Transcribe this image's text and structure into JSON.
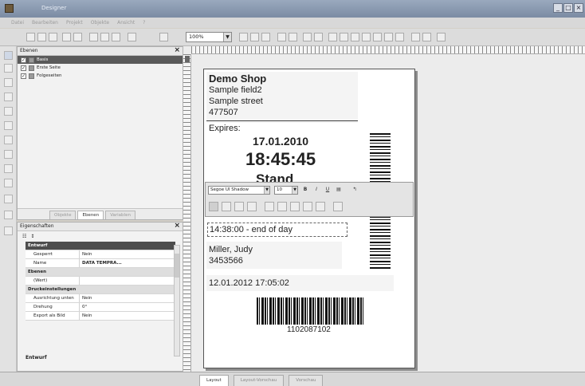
{
  "window": {
    "title": "Designer",
    "controls": [
      "_",
      "□",
      "×"
    ]
  },
  "menu": [
    "Datei",
    "Bearbeiten",
    "Projekt",
    "Objekte",
    "Ansicht",
    "?"
  ],
  "toolbar": {
    "zoom": "100%"
  },
  "layers_panel": {
    "title": "Ebenen",
    "items": [
      {
        "label": "Basis",
        "checked": true,
        "selected": true
      },
      {
        "label": "Erste Seite",
        "checked": true,
        "selected": false
      },
      {
        "label": "Folgeseiten",
        "checked": true,
        "selected": false
      }
    ],
    "tabs": [
      "Objekte",
      "Ebenen",
      "Variablen"
    ]
  },
  "properties_panel": {
    "title": "Eigenschaften",
    "rows": [
      {
        "type": "group",
        "key": "Entwurf"
      },
      {
        "type": "row",
        "key": "Gesperrt",
        "value": "Nein"
      },
      {
        "type": "row",
        "key": "Name",
        "value": "DATA TEMPRA..."
      },
      {
        "type": "group",
        "key": "Ebenen"
      },
      {
        "type": "row",
        "key": "(Wert)",
        "value": ""
      },
      {
        "type": "group",
        "key": "Druckeinstellungen"
      },
      {
        "type": "row",
        "key": "Ausrichtung unten",
        "value": "Nein"
      },
      {
        "type": "row",
        "key": "Drehung",
        "value": "0°"
      },
      {
        "type": "row",
        "key": "Export als Bild",
        "value": "Nein"
      }
    ],
    "footer": "Entwurf"
  },
  "label": {
    "shop_name": "Demo Shop",
    "address1": "Sample field2",
    "address2": "Sample street",
    "zip": "477507",
    "expires_label": "Expires:",
    "date": "17.01.2010",
    "time": "18:45:45",
    "stamp_partial": "Stand",
    "deadline": "14:38:00 - end of day",
    "customer_name": "Miller, Judy",
    "customer_id": "3453566",
    "printed_at": "12.01.2012 17:05:02",
    "barcode_number": "1102087102"
  },
  "format_toolbar": {
    "font": "Segoe UI Shadow",
    "size": "10"
  },
  "bottom_tabs": [
    "Layout",
    "Layout-Vorschau",
    "Vorschau"
  ]
}
